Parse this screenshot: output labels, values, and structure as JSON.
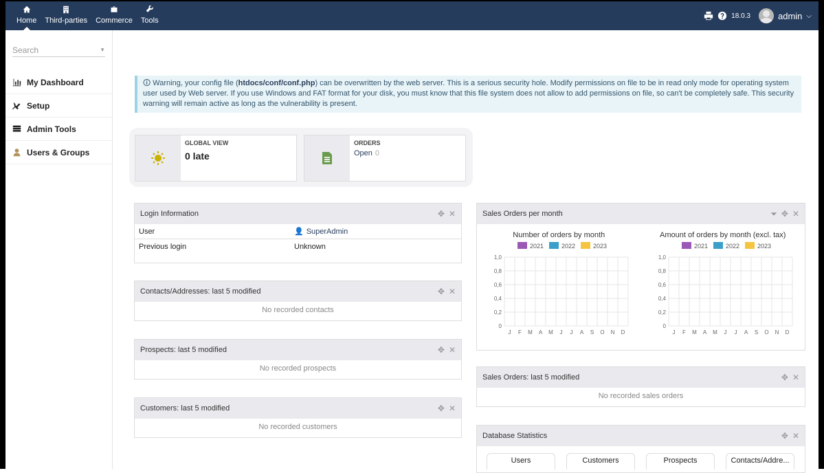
{
  "topmenu": [
    {
      "label": "Home",
      "icon": "home-icon"
    },
    {
      "label": "Third-parties",
      "icon": "building-icon"
    },
    {
      "label": "Commerce",
      "icon": "briefcase-icon"
    },
    {
      "label": "Tools",
      "icon": "wrench-icon"
    }
  ],
  "topright": {
    "version": "18.0.3",
    "user": "admin"
  },
  "sidebar": {
    "search_placeholder": "Search",
    "items": [
      {
        "label": "My Dashboard",
        "icon": "chart-icon"
      },
      {
        "label": "Setup",
        "icon": "tools-icon"
      },
      {
        "label": "Admin Tools",
        "icon": "server-icon"
      },
      {
        "label": "Users & Groups",
        "icon": "user-icon"
      }
    ]
  },
  "warning": {
    "prefix": "Warning, your config file (",
    "file": "htdocs/conf/conf.php",
    "suffix": ") can be overwritten by the web server. This is a serious security hole. Modify permissions on file to be in read only mode for operating system user used by Web server. If you use Windows and FAT format for your disk, you must know that this file system does not allow to add permissions on file, so can't be completely safe. This security warning will remain active as long as the vulnerability is present."
  },
  "boxes": {
    "global": {
      "label": "GLOBAL VIEW",
      "value": "0 late"
    },
    "orders": {
      "label": "ORDERS",
      "open_label": "Open",
      "open_count": "0"
    }
  },
  "login": {
    "title": "Login Information",
    "rows": [
      {
        "label": "User",
        "value": "SuperAdmin"
      },
      {
        "label": "Previous login",
        "value": "Unknown"
      }
    ]
  },
  "contacts": {
    "title": "Contacts/Addresses: last 5 modified",
    "empty": "No recorded contacts"
  },
  "prospects": {
    "title": "Prospects: last 5 modified",
    "empty": "No recorded prospects"
  },
  "customers": {
    "title": "Customers: last 5 modified",
    "empty": "No recorded customers"
  },
  "sales_chart": {
    "title": "Sales Orders per month"
  },
  "sales_orders": {
    "title": "Sales Orders: last 5 modified",
    "empty": "No recorded sales orders"
  },
  "dbstats": {
    "title": "Database Statistics",
    "tabs": [
      "Users",
      "Customers",
      "Prospects",
      "Contacts/Addre..."
    ]
  },
  "chart_data": [
    {
      "type": "bar",
      "title": "Number of orders by month",
      "categories": [
        "J",
        "F",
        "M",
        "A",
        "M",
        "J",
        "J",
        "A",
        "S",
        "O",
        "N",
        "D"
      ],
      "series": [
        {
          "name": "2021",
          "values": [
            0,
            0,
            0,
            0,
            0,
            0,
            0,
            0,
            0,
            0,
            0,
            0
          ]
        },
        {
          "name": "2022",
          "values": [
            0,
            0,
            0,
            0,
            0,
            0,
            0,
            0,
            0,
            0,
            0,
            0
          ]
        },
        {
          "name": "2023",
          "values": [
            0,
            0,
            0,
            0,
            0,
            0,
            0,
            0,
            0,
            0,
            0,
            0
          ]
        }
      ],
      "yticks": [
        "1,0",
        "0,8",
        "0,6",
        "0,4",
        "0,2",
        "0"
      ],
      "ylim": [
        0,
        1
      ],
      "colors": [
        "#9b59b6",
        "#3a9fc9",
        "#f5c542"
      ],
      "legend": "top"
    },
    {
      "type": "bar",
      "title": "Amount of orders by month (excl. tax)",
      "categories": [
        "J",
        "F",
        "M",
        "A",
        "M",
        "J",
        "J",
        "A",
        "S",
        "O",
        "N",
        "D"
      ],
      "series": [
        {
          "name": "2021",
          "values": [
            0,
            0,
            0,
            0,
            0,
            0,
            0,
            0,
            0,
            0,
            0,
            0
          ]
        },
        {
          "name": "2022",
          "values": [
            0,
            0,
            0,
            0,
            0,
            0,
            0,
            0,
            0,
            0,
            0,
            0
          ]
        },
        {
          "name": "2023",
          "values": [
            0,
            0,
            0,
            0,
            0,
            0,
            0,
            0,
            0,
            0,
            0,
            0
          ]
        }
      ],
      "yticks": [
        "1,0",
        "0,8",
        "0,6",
        "0,4",
        "0,2",
        "0"
      ],
      "ylim": [
        0,
        1
      ],
      "colors": [
        "#9b59b6",
        "#3a9fc9",
        "#f5c542"
      ],
      "legend": "top"
    }
  ]
}
